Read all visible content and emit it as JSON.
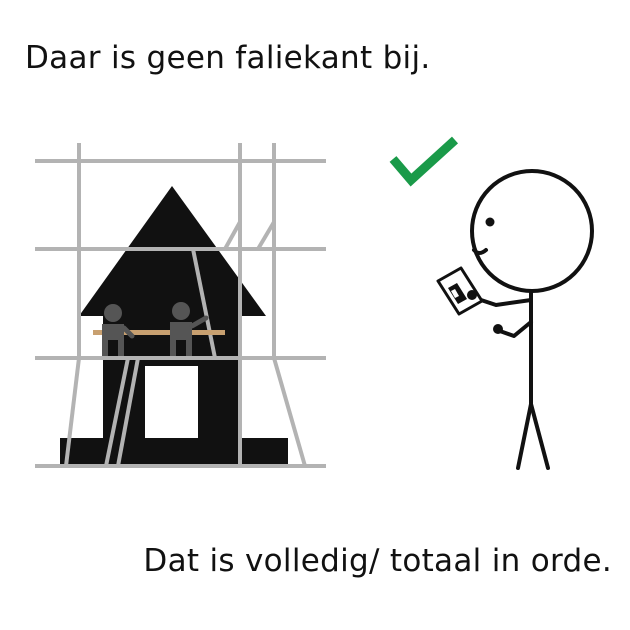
{
  "top_caption": "Daar is geen faliekant bij.",
  "bottom_caption": "Dat is volledig/ totaal in orde.",
  "colors": {
    "scaffold": "#b3b3b3",
    "house": "#111111",
    "workers": "#555555",
    "plank": "#c8a070",
    "checkmark": "#1a9a49",
    "stick_figure": "#111111"
  },
  "icons": [
    "house-icon",
    "scaffold-icon",
    "checkmark-icon",
    "stick-figure-icon",
    "clipboard-icon"
  ]
}
